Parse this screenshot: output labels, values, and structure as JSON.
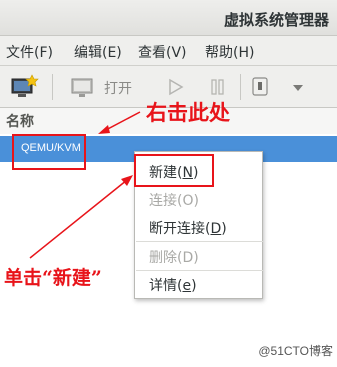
{
  "window": {
    "title": "虚拟系统管理器"
  },
  "menubar": {
    "items": [
      {
        "label": "文件(F)"
      },
      {
        "label": "编辑(E)"
      },
      {
        "label": "查看(V)"
      },
      {
        "label": "帮助(H)"
      }
    ]
  },
  "toolbar": {
    "open_label": "打开"
  },
  "list": {
    "column_header": "名称",
    "rows": [
      {
        "label": "QEMU/KVM",
        "selected": true
      }
    ]
  },
  "context_menu": {
    "items": [
      {
        "label": "新建(",
        "mnemonic": "N",
        "close": ")",
        "enabled": true
      },
      {
        "label": "连接(O)",
        "enabled": false
      },
      {
        "label": "断开连接(",
        "mnemonic": "D",
        "close": ")",
        "enabled": true
      },
      {
        "label": "删除(D)",
        "enabled": false
      },
      {
        "label": "详情(",
        "mnemonic": "e",
        "close": ")",
        "enabled": true
      }
    ]
  },
  "annotations": {
    "right_click": "右击此处",
    "single_click": "单击“新建”",
    "color": "#e8141a"
  },
  "watermark": "@51CTO博客",
  "colors": {
    "selection": "#4a90d9",
    "annotation": "#e8141a"
  }
}
